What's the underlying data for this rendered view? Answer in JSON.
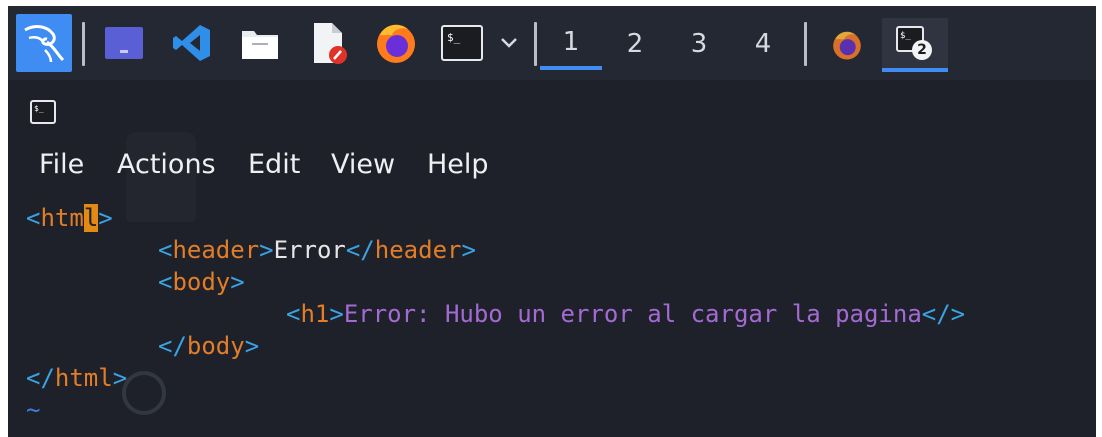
{
  "taskbar": {
    "launchers": [
      {
        "icon": "kali-dragon-icon"
      },
      {
        "icon": "show-desktop-icon"
      },
      {
        "icon": "vscode-icon"
      },
      {
        "icon": "file-manager-icon"
      },
      {
        "icon": "text-editor-icon"
      },
      {
        "icon": "firefox-icon"
      },
      {
        "icon": "terminal-icon"
      },
      {
        "icon": "chevron-down-icon"
      }
    ],
    "workspaces": [
      "1",
      "2",
      "3",
      "4"
    ],
    "active_workspace": "1",
    "tasks": [
      {
        "icon": "firefox-icon",
        "active": false
      },
      {
        "icon": "terminal-icon",
        "badge": "2",
        "active": true
      }
    ]
  },
  "window": {
    "icon": "terminal-icon"
  },
  "menu": {
    "items": [
      "File",
      "Actions",
      "Edit",
      "View",
      "Help"
    ]
  },
  "editor": {
    "line1": {
      "open": "<",
      "name_a": "htm",
      "cursor_char": "l",
      "close": ">"
    },
    "line2": {
      "open": "<",
      "name": "header",
      "close": ">",
      "text": "Error",
      "end_open": "</",
      "end_name": "header",
      "end_close": ">"
    },
    "line3": {
      "open": "<",
      "name": "body",
      "close": ">"
    },
    "line4": {
      "open": "<",
      "name": "h1",
      "close": ">",
      "text": "Error: Hubo un error al cargar la pagina",
      "end": "</>"
    },
    "line5": {
      "open": "</",
      "name": "body",
      "close": ">"
    },
    "line6": {
      "open": "</",
      "name": "html",
      "close": ">"
    },
    "tilde": "~"
  },
  "colors": {
    "accent": "#3f8cf2",
    "tag_bracket": "#3aa3e3",
    "tag_name": "#e27d28",
    "string_purple": "#a36ad4",
    "background": "#1e2129"
  }
}
